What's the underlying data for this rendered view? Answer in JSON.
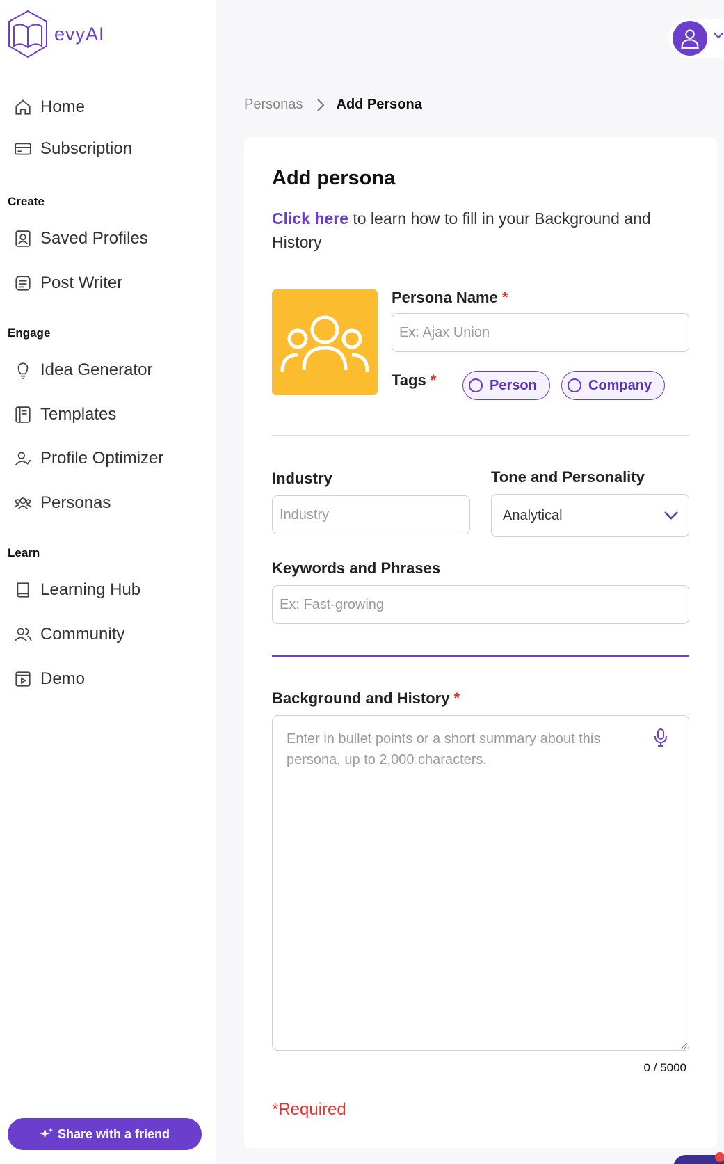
{
  "app": {
    "name": "evyAI"
  },
  "sidebar": {
    "items_top": [
      {
        "label": "Home",
        "icon": "home-icon"
      },
      {
        "label": "Subscription",
        "icon": "credit-card-icon"
      }
    ],
    "sections": [
      {
        "title": "Create",
        "items": [
          {
            "label": "Saved Profiles",
            "icon": "profile-card-icon"
          },
          {
            "label": "Post Writer",
            "icon": "document-lines-icon"
          }
        ]
      },
      {
        "title": "Engage",
        "items": [
          {
            "label": "Idea Generator",
            "icon": "lightbulb-icon"
          },
          {
            "label": "Templates",
            "icon": "template-icon"
          },
          {
            "label": "Profile Optimizer",
            "icon": "user-check-icon"
          },
          {
            "label": "Personas",
            "icon": "users-group-icon"
          }
        ]
      },
      {
        "title": "Learn",
        "items": [
          {
            "label": "Learning Hub",
            "icon": "book-icon"
          },
          {
            "label": "Community",
            "icon": "users-icon"
          },
          {
            "label": "Demo",
            "icon": "play-square-icon"
          }
        ]
      }
    ],
    "share_label": "Share with a friend"
  },
  "breadcrumb": {
    "parent": "Personas",
    "current": "Add Persona"
  },
  "form": {
    "title": "Add persona",
    "help_link": "Click here",
    "help_text": " to learn how to fill in your Background and History",
    "persona_name_label": "Persona Name",
    "persona_name_placeholder": "Ex: Ajax Union",
    "required_mark": "*",
    "tags_label": "Tags",
    "tags": [
      "Person",
      "Company"
    ],
    "industry_label": "Industry",
    "industry_placeholder": "Industry",
    "tone_label": "Tone and Personality",
    "tone_value": "Analytical",
    "keywords_label": "Keywords and Phrases",
    "keywords_placeholder": "Ex: Fast-growing",
    "background_label": "Background and History",
    "background_placeholder": "Enter in bullet points or a short summary about this persona, up to 2,000 characters.",
    "char_counter": "0 / 5000",
    "required_note": "*Required"
  },
  "colors": {
    "accent": "#6b3fcb",
    "persona_bg": "#fbbd2f",
    "required": "#e0332f"
  }
}
